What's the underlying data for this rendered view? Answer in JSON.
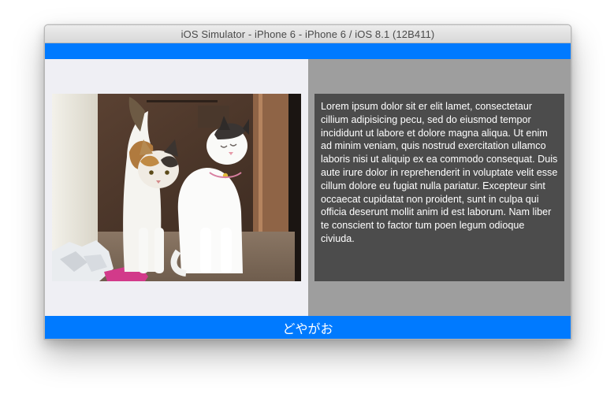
{
  "window": {
    "title": "iOS Simulator - iPhone 6 - iPhone 6 / iOS 8.1 (12B411)"
  },
  "app": {
    "top_bar_color": "#007aff",
    "left_pane_color": "#efeff4",
    "right_pane_color": "#9e9e9e",
    "text_box_color": "#4c4c4c",
    "photo": {
      "subject": "two-cats-photo"
    },
    "body_text": "Lorem ipsum dolor sit er elit lamet, consectetaur cillium adipisicing pecu, sed do eiusmod tempor incididunt ut labore et dolore magna aliqua. Ut enim ad minim veniam, quis nostrud exercitation ullamco laboris nisi ut aliquip ex ea commodo consequat. Duis aute irure dolor in reprehenderit in voluptate velit esse cillum dolore eu fugiat nulla pariatur. Excepteur sint occaecat cupidatat non proident, sunt in culpa qui officia deserunt mollit anim id est laborum. Nam liber te conscient to factor tum poen legum odioque civiuda.",
    "bottom_bar_label": "どやがお"
  }
}
